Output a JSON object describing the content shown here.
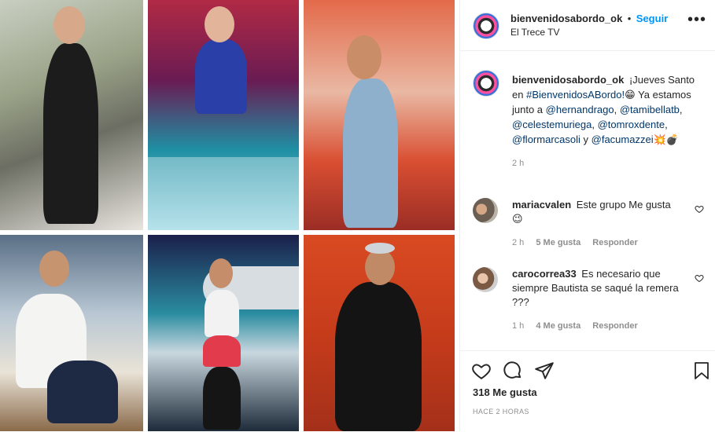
{
  "header": {
    "username": "bienvenidosabordo_ok",
    "separator": "•",
    "follow_label": "Seguir",
    "subtitle": "El Trece TV"
  },
  "caption": {
    "username": "bienvenidosabordo_ok",
    "text_1": "¡Jueves Santo en",
    "hashtag": "#BienvenidosABordo!",
    "emoji_1": "😁",
    "text_2": "Ya estamos junto a",
    "mention_1": "@hernandrago",
    "mention_2": "@tamibellatb",
    "mention_3": "@celestemuriega",
    "mention_4": "@tomroxdente",
    "mention_5": "@flormarcasoli",
    "text_3": "y",
    "mention_6": "@facumazzei",
    "emoji_2": "💥💣",
    "time": "2 h"
  },
  "comments": [
    {
      "username": "mariacvalen",
      "text": "Este grupo Me gusta",
      "emoji": "😉",
      "time": "2 h",
      "likes": "5 Me gusta",
      "reply": "Responder"
    },
    {
      "username": "carocorrea33",
      "text": "Es necesario que siempre Bautista se saqué la remera ???",
      "time": "1 h",
      "likes": "4 Me gusta",
      "reply": "Responder"
    }
  ],
  "footer": {
    "likes": "318 Me gusta",
    "timestamp": "HACE 2 HORAS"
  },
  "colors": {
    "accent": "#0095f6",
    "text": "#262626",
    "muted": "#8e8e8e",
    "link": "#00376b"
  }
}
